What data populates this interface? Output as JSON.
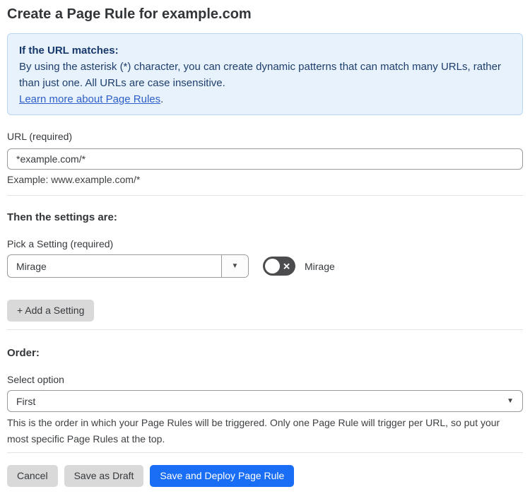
{
  "page": {
    "title": "Create a Page Rule for example.com"
  },
  "info_box": {
    "heading": "If the URL matches:",
    "body": "By using the asterisk (*) character, you can create dynamic patterns that can match many URLs, rather than just one. All URLs are case insensitive.",
    "link_label": "Learn more about Page Rules",
    "link_suffix": "."
  },
  "url_field": {
    "label": "URL (required)",
    "value": "*example.com/*",
    "helper": "Example: www.example.com/*"
  },
  "settings_section": {
    "heading": "Then the settings are:",
    "picker_label": "Pick a Setting (required)",
    "picker_value": "Mirage",
    "toggle_label": "Mirage",
    "toggle_state": "off",
    "add_setting_label": "+ Add a Setting"
  },
  "order_section": {
    "heading": "Order:",
    "select_label": "Select option",
    "select_value": "First",
    "helper": "This is the order in which your Page Rules will be triggered. Only one Page Rule will trigger per URL, so put your most specific Page Rules at the top."
  },
  "footer": {
    "cancel_label": "Cancel",
    "save_draft_label": "Save as Draft",
    "save_deploy_label": "Save and Deploy Page Rule"
  },
  "glyphs": {
    "caret_down": "▼",
    "toggle_x": "✕"
  },
  "colors": {
    "info_bg": "#e8f2fc",
    "info_border": "#b9d5f1",
    "info_text": "#1e3e6d",
    "link_blue": "#2d5ec9",
    "primary_blue": "#1a6ef5",
    "button_gray": "#d9d9d9",
    "toggle_off_bg": "#4c4c4e",
    "text_dark": "#35393d"
  }
}
